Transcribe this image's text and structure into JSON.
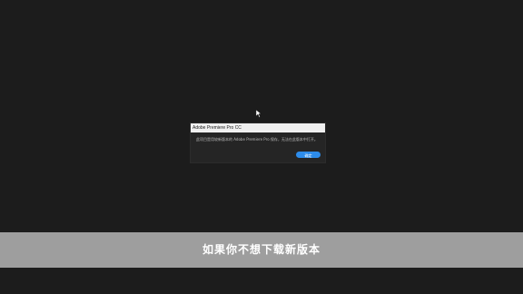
{
  "dialog": {
    "title": "Adobe Premiere Pro CC",
    "message": "此项目是用较新版本的 Adobe Premiere Pro 保存，无法在此版本中打开。",
    "ok_button_label": "确定"
  },
  "subtitle": {
    "text": "如果你不想下载新版本"
  },
  "colors": {
    "background": "#1c1c1c",
    "dialog_body": "#252525",
    "titlebar": "#f0f0f0",
    "button": "#2d8ceb",
    "subtitle_band": "#9e9e9e"
  },
  "icons": {
    "cursor": "arrow-cursor-icon"
  }
}
